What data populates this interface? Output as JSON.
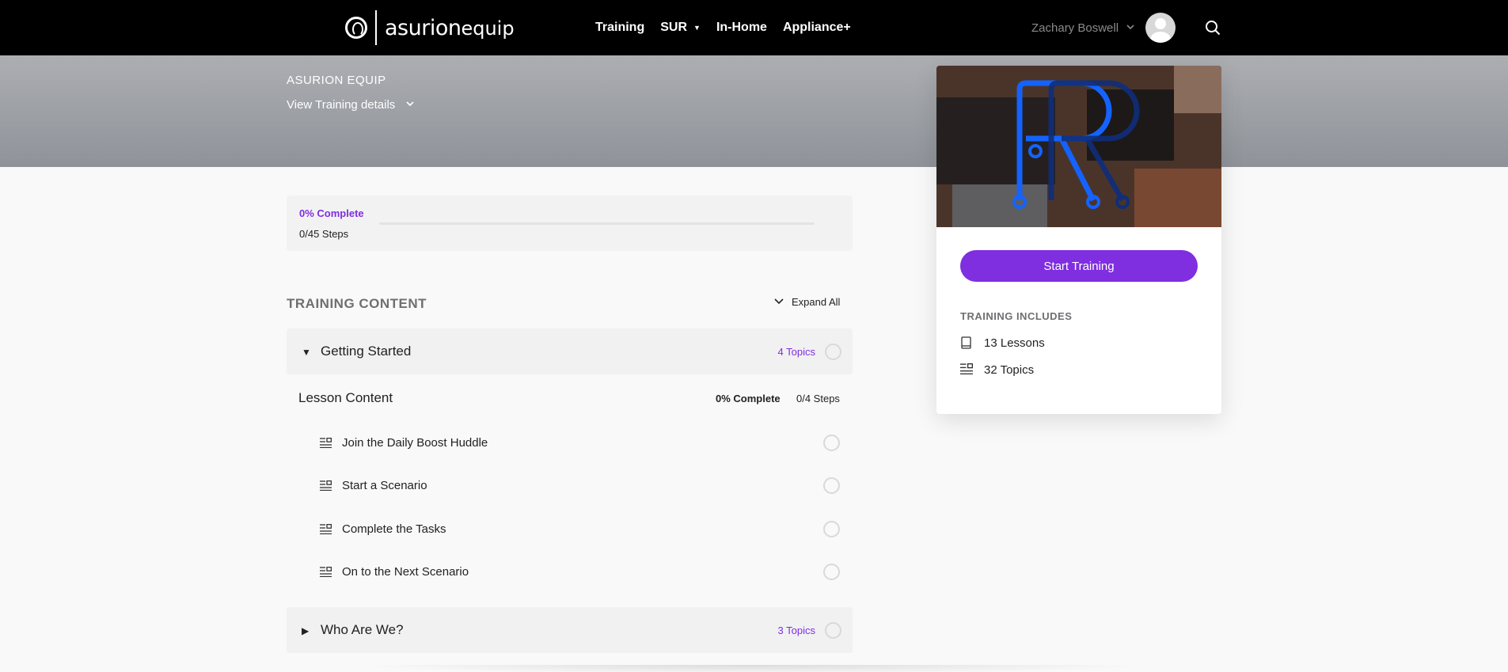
{
  "brand": {
    "name": "asurion",
    "product": "equip"
  },
  "nav": {
    "items": [
      {
        "label": "Training",
        "has_dropdown": false
      },
      {
        "label": "SUR",
        "has_dropdown": true
      },
      {
        "label": "In-Home",
        "has_dropdown": false
      },
      {
        "label": "Appliance+",
        "has_dropdown": false
      }
    ]
  },
  "user": {
    "name": "Zachary Boswell"
  },
  "header": {
    "title": "ASURION EQUIP",
    "details_link": "View Training details"
  },
  "progress": {
    "percent_label": "0% Complete",
    "percent": 0,
    "steps_label": "0/45 Steps"
  },
  "content": {
    "section_title": "TRAINING CONTENT",
    "expand_all": "Expand All",
    "lessons": [
      {
        "title": "Getting Started",
        "topics_label": "4 Topics",
        "expanded": true,
        "lesson_content_label": "Lesson Content",
        "complete_label": "0% Complete",
        "steps_label": "0/4 Steps",
        "topics": [
          "Join the Daily Boost Huddle",
          "Start a Scenario",
          "Complete the Tasks",
          "On to the Next Scenario"
        ]
      },
      {
        "title": "Who Are We?",
        "topics_label": "3 Topics",
        "expanded": false
      }
    ]
  },
  "sidebar": {
    "start_button": "Start Training",
    "includes_title": "TRAINING INCLUDES",
    "includes": [
      {
        "icon": "book-icon",
        "label": "13 Lessons"
      },
      {
        "icon": "topic-list-icon",
        "label": "32 Topics"
      }
    ]
  },
  "colors": {
    "accent": "#7f2ee0",
    "topbar": "#000000",
    "band": "#9a9da2"
  }
}
